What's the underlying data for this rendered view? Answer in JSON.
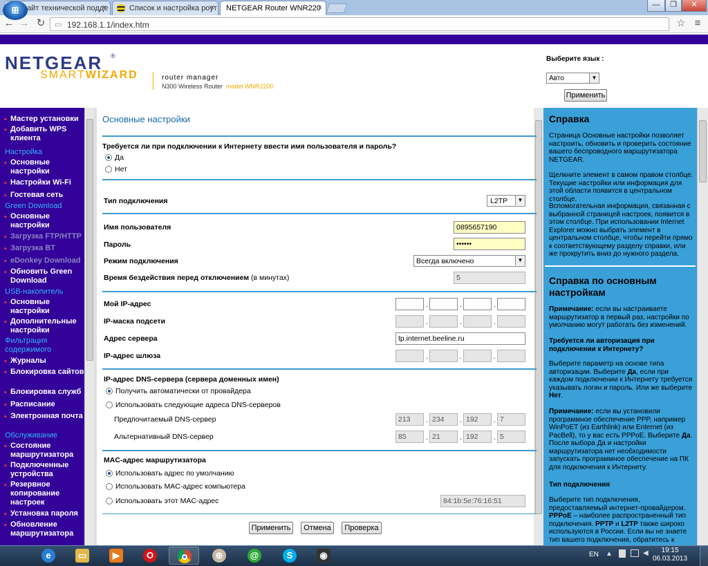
{
  "browser": {
    "tabs": [
      {
        "label": "Сайт технической подде",
        "close": "×"
      },
      {
        "label": "Список и настройка роут",
        "close": "×"
      },
      {
        "label": "NETGEAR Router WNR220",
        "close": "×"
      }
    ],
    "url": "192.168.1.1/index.htm",
    "window_buttons": [
      "—",
      "❐",
      "✕"
    ],
    "nav": {
      "back": "←",
      "forward": "→",
      "reload": "↻",
      "star": "☆",
      "menu": "≡"
    }
  },
  "header": {
    "logo_brand": "NETGEAR",
    "logo_reg": "®",
    "logo_smart": "SMART",
    "logo_wizard": "WIZARD",
    "router_manager": "router manager",
    "model_line": "N300 Wireless Router",
    "model_name": "model WNR2200",
    "lang_label": "Выберите язык :",
    "lang_value": "Авто",
    "apply_label": "Применить"
  },
  "sidebar": {
    "items": [
      {
        "type": "item",
        "label": "Мастер установки"
      },
      {
        "type": "item",
        "label": "Добавить WPS клиента"
      },
      {
        "type": "cat",
        "label": "Настройка"
      },
      {
        "type": "item",
        "label": "Основные настройки"
      },
      {
        "type": "item",
        "label": "Настройки Wi-Fi"
      },
      {
        "type": "item",
        "label": "Гостевая сеть"
      },
      {
        "type": "cat",
        "label": "Green Download"
      },
      {
        "type": "item",
        "label": "Основные настройки"
      },
      {
        "type": "dim",
        "label": "Загрузка FTP/HTTP"
      },
      {
        "type": "dim",
        "label": "Загрузка BT"
      },
      {
        "type": "dim",
        "label": "eDonkey Download"
      },
      {
        "type": "item",
        "label": "Обновить Green Download"
      },
      {
        "type": "cat",
        "label": "USB-накопитель"
      },
      {
        "type": "item",
        "label": "Основные настройки"
      },
      {
        "type": "item",
        "label": "Дополнительные настройки"
      },
      {
        "type": "cat",
        "label": "Фильтрация содержимого"
      },
      {
        "type": "item",
        "label": "Журналы"
      },
      {
        "type": "item",
        "label": "Блокировка сайтов"
      },
      {
        "type": "item",
        "label": "Блокировка служб"
      },
      {
        "type": "item",
        "label": "Расписание"
      },
      {
        "type": "item",
        "label": "Электронная почта"
      },
      {
        "type": "cat",
        "label": "Обслуживание"
      },
      {
        "type": "item",
        "label": "Состояние маршрутизатора"
      },
      {
        "type": "item",
        "label": "Подключенные устройства"
      },
      {
        "type": "item",
        "label": "Резервное копирование настроек"
      },
      {
        "type": "item",
        "label": "Установка пароля"
      },
      {
        "type": "item",
        "label": "Обновление маршрутизатора"
      }
    ]
  },
  "main": {
    "title": "Основные настройки",
    "q_login": "Требуется ли при подключении к Интернету ввести имя пользователя и пароль?",
    "yes": "Да",
    "no": "Нет",
    "conn_type_label": "Тип подключения",
    "conn_type_value": "L2TP",
    "username_label": "Имя пользователя",
    "username_value": "0895657190",
    "password_label": "Пароль",
    "password_value": "••••••",
    "mode_label": "Режим подключения",
    "mode_value": "Всегда включено",
    "idle_label": "Время бездействия перед отключением",
    "idle_unit": "(в минутах)",
    "idle_value": "5",
    "my_ip_label": "Мой IP-адрес",
    "mask_label": "IP-маска подсети",
    "server_label": "Адрес сервера",
    "server_value": "tp.internet.beeline.ru",
    "gateway_label": "IP-адрес шлюза",
    "dns_title": "IP-адрес DNS-сервера (сервера доменных имен)",
    "dns_auto": "Получить автоматически от провайдера",
    "dns_manual": "Использовать следующие адреса DNS-серверов",
    "dns_pref_label": "Предпочитаемый DNS-сервер",
    "dns_pref": [
      "213",
      "234",
      "192",
      "7"
    ],
    "dns_alt_label": "Альтернативный DNS-сервер",
    "dns_alt": [
      "85",
      "21",
      "192",
      "5"
    ],
    "mac_title": "MAC-адрес маршрутизатора",
    "mac_default": "Использовать адрес по умолчанию",
    "mac_computer": "Использовать MAC-адрес компьютера",
    "mac_this": "Использовать этот MAC-адрес",
    "mac_value": "84:1b:5e:76:16:51",
    "btn_apply": "Применить",
    "btn_cancel": "Отмена",
    "btn_check": "Проверка"
  },
  "help": {
    "title1": "Справка",
    "p1": "Страница Основные настройки позволяет настроить, обновить и проверить состояние вашего беспроводного маршрутизатора NETGEAR.",
    "p2": "Щелкните элемент в самом правом столбце. Текущие настройки или информация для этой области появится в центральном столбце.",
    "p3": "Вспомогательная информация, связанная с выбранной страницей настроек, появится в этом столбце. При использовании Internet Explorer можно выбрать элемент в центральном столбце, чтобы перейти прямо к соответствующему разделу справки, или же прокрутить вниз до нужного раздела.",
    "title2": "Справка по основным настройкам",
    "note1_b": "Примечание:",
    "note1": "если вы настраиваете маршрутизатор в первый раз, настройки по умолчанию могут работать без изменений.",
    "q": "Требуется ли авторизация при подключении к Интернету?",
    "p4_a": "Выберите параметр на основе типа авторизации. Выберите ",
    "p4_yes": "Да",
    "p4_b": ", если при каждом подключении к Интернету требуется указывать логин и пароль. Или же выберите ",
    "p4_no": "Нет",
    "p4_c": ".",
    "note2_b": "Примечание:",
    "note2_a": " если вы установили программное обеспечение PPP, например WinPoET (из Earthlink) или Enternet (из PacBell), то у вас есть PPPoE. Выберите ",
    "note2_yes": "Да",
    "note2_c": ". После выбора Да и настройки маршрутизатора нет необходимости запускать программное обеспечение на ПК для подключения к Интернету.",
    "conn_type_h": "Тип подключения",
    "p5_a": "Выберите тип подключения, предоставляемый интернет-провайдером. ",
    "p5_pppoe": "PPPoE",
    "p5_b": " – наиболее распространенный тип подключения. ",
    "p5_pptp": "PPTP",
    "p5_c": " и ",
    "p5_l2tp": "L2TP",
    "p5_d": " также широко используются в России. Если вы не знаете тип вашего подключения, обратитесь к вашему"
  },
  "taskbar": {
    "lang": "EN",
    "time": "19:15",
    "date": "06.03.2013",
    "icons": [
      "ie-icon",
      "explorer-icon",
      "media-player-icon",
      "opera-icon",
      "chrome-icon",
      "network-icon",
      "mail-agent-icon",
      "skype-icon",
      "camera-icon"
    ]
  },
  "colors": {
    "purple": "#330099",
    "help_bg": "#3aa0d8",
    "title_blue": "#1a6aa6",
    "rule_blue": "#3e9ad3",
    "logo_orange": "#f5a800"
  }
}
